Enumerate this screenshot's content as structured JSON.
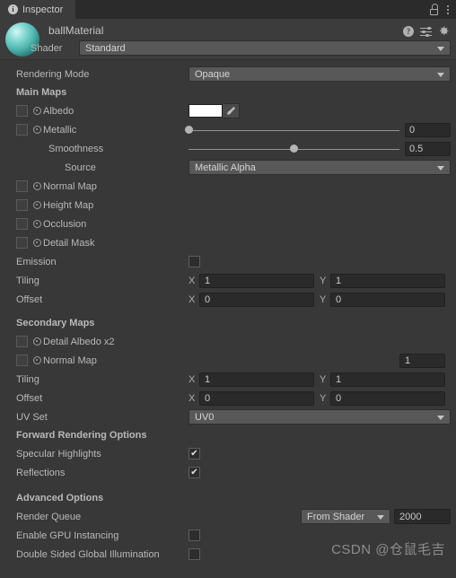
{
  "window": {
    "tab_label": "Inspector",
    "tab_icon": "info-icon",
    "lock_icon": "lock-icon",
    "menu_icon": "kebab-menu-icon"
  },
  "material": {
    "name": "ballMaterial",
    "preview_icon": "sphere-preview",
    "help_icon": "help-icon",
    "preset_icon": "preset-sliders-icon",
    "settings_icon": "gear-icon",
    "shader_label": "Shader",
    "shader_value": "Standard"
  },
  "properties": {
    "rendering_mode_label": "Rendering Mode",
    "rendering_mode_value": "Opaque",
    "main_maps_header": "Main Maps",
    "albedo_label": "Albedo",
    "albedo_color": "#ffffff",
    "eyedropper_icon": "eyedropper-icon",
    "metallic_label": "Metallic",
    "metallic_value": "0",
    "metallic_pct": 0,
    "smoothness_label": "Smoothness",
    "smoothness_value": "0.5",
    "smoothness_pct": 50,
    "source_label": "Source",
    "source_value": "Metallic Alpha",
    "normal_map_label": "Normal Map",
    "height_map_label": "Height Map",
    "occlusion_label": "Occlusion",
    "detail_mask_label": "Detail Mask",
    "emission_label": "Emission",
    "emission_checked": false,
    "tiling_label": "Tiling",
    "tiling_x": "1",
    "tiling_y": "1",
    "offset_label": "Offset",
    "offset_x": "0",
    "offset_y": "0",
    "axis_x": "X",
    "axis_y": "Y"
  },
  "secondary": {
    "header": "Secondary Maps",
    "detail_albedo_label": "Detail Albedo x2",
    "normal_map_label": "Normal Map",
    "normal_map_value": "1",
    "tiling_label": "Tiling",
    "tiling_x": "1",
    "tiling_y": "1",
    "offset_label": "Offset",
    "offset_x": "0",
    "offset_y": "0",
    "uv_set_label": "UV Set",
    "uv_set_value": "UV0"
  },
  "forward": {
    "header": "Forward Rendering Options",
    "specular_label": "Specular Highlights",
    "specular_checked": true,
    "reflections_label": "Reflections",
    "reflections_checked": true,
    "check_glyph": "✔"
  },
  "advanced": {
    "header": "Advanced Options",
    "render_queue_label": "Render Queue",
    "render_queue_mode": "From Shader",
    "render_queue_value": "2000",
    "gpu_instancing_label": "Enable GPU Instancing",
    "gpu_instancing_checked": false,
    "double_sided_label": "Double Sided Global Illumination",
    "double_sided_checked": false
  },
  "watermark": {
    "text": "CSDN @仓鼠毛吉"
  }
}
